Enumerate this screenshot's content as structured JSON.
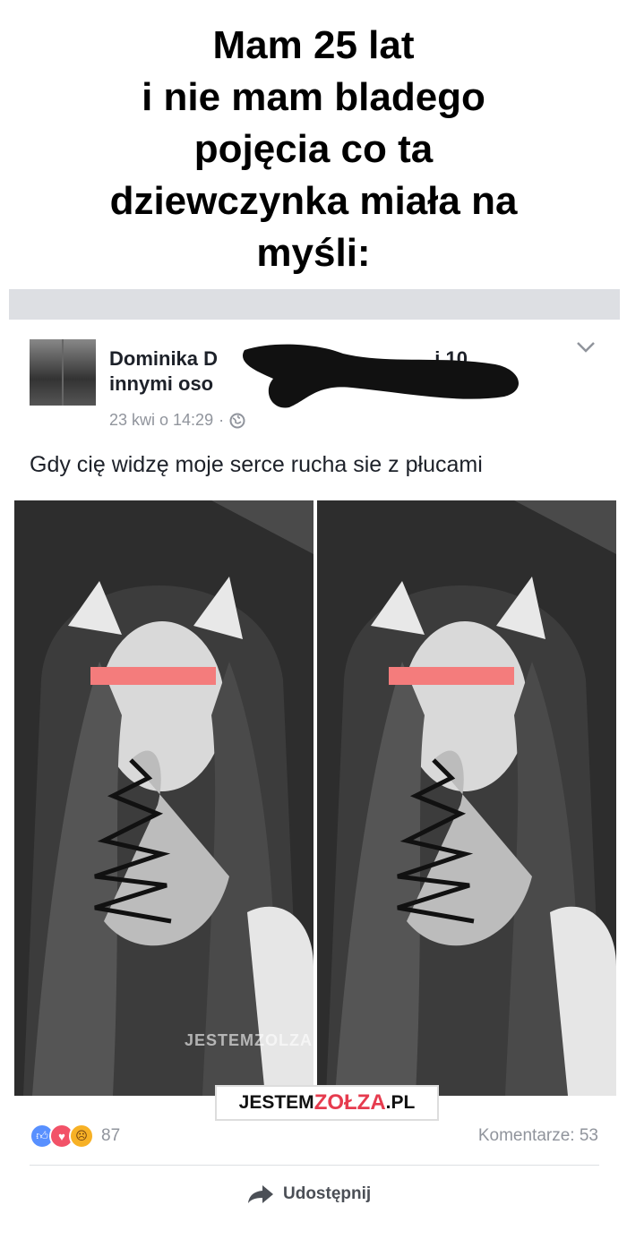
{
  "headline": {
    "lines": [
      "Mam 25 lat",
      "i nie mam bladego",
      "pojęcia co ta",
      "dziewczynka miała na",
      "myśli:"
    ]
  },
  "post": {
    "author_line1": "Dominika D",
    "author_line1_tail": "i 10",
    "author_line2": "innymi oso",
    "timestamp": "23 kwi o 14:29",
    "separator": "·",
    "privacy_icon": "globe-icon",
    "options_icon": "chevron-down-icon",
    "status_text": "Gdy cię widzę moje serce rucha sie z płucami",
    "photo_watermark": "JESTEMZOLZA.PL",
    "reactions": {
      "icons": [
        "like-icon",
        "love-icon",
        "angry-icon"
      ],
      "count": "87"
    },
    "comments_label": "Komentarze: 53",
    "share_label": "Udostępnij"
  },
  "logo": {
    "part1": "JESTEM",
    "part2": "ZOŁZA",
    "part3": ".PL"
  },
  "colors": {
    "accent_red": "#e63b4e",
    "censor_bar": "#f47c7c",
    "meta_grey": "#90949c",
    "like_blue": "#5890ff"
  }
}
